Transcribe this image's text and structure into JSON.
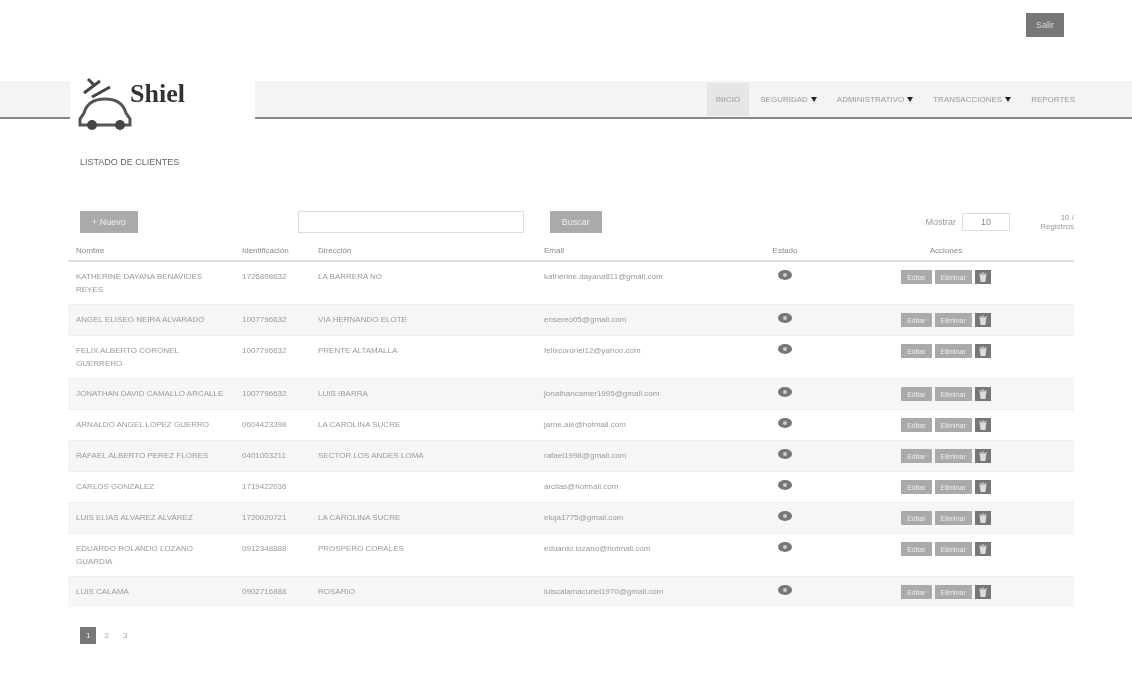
{
  "top_button": "Salir",
  "brand": "Shiel",
  "nav": [
    {
      "label": "INICIO",
      "selected": true,
      "dropdown": false
    },
    {
      "label": "SEGURIDAD",
      "selected": false,
      "dropdown": true
    },
    {
      "label": "ADMINISTRATIVO",
      "selected": false,
      "dropdown": true
    },
    {
      "label": "TRANSACCIONES",
      "selected": false,
      "dropdown": true
    },
    {
      "label": "REPORTES",
      "selected": false,
      "dropdown": false
    }
  ],
  "page_title": "LISTADO DE CLIENTES",
  "toolbar": {
    "new_button": "+ Nuevo",
    "search_button": "Buscar",
    "show_label": "Mostrar",
    "page_size": "10",
    "records_label": "10 / Registros"
  },
  "table": {
    "columns": [
      "Nombre",
      "Identificación",
      "Dirección",
      "Email",
      "Estado",
      "Acciones"
    ],
    "rows": [
      {
        "name": "KATHERINE DAYANA BENAVIDES REYES",
        "id": "1726808632",
        "address": "LA BARRERA NO",
        "email": "katherine.dayana811@gmail.com",
        "edit": "Editar",
        "delete": "Eliminar"
      },
      {
        "name": "ANGEL ELISEO NEIRA ALVARADO",
        "id": "1007796632",
        "address": "VIA HERNANDO ELOTE",
        "email": "ensereo05@gmail.com",
        "edit": "Editar",
        "delete": "Eliminar"
      },
      {
        "name": "FELIX ALBERTO CORONEL GUERRERO",
        "id": "1007796632",
        "address": "PRENTE ALTAMALLA",
        "email": "felixcoronel12@yahoo.com",
        "edit": "Editar",
        "delete": "Eliminar"
      },
      {
        "name": "JONATHAN DAVID CAMALLO ARCALLE",
        "id": "1007796632",
        "address": "LUIS IBARRA",
        "email": "jonathancamer1995@gmail.com",
        "edit": "Editar",
        "delete": "Eliminar"
      },
      {
        "name": "ARNALDO ANGEL LOPEZ GUERRO",
        "id": "0604423398",
        "address": "LA CAROLINA SUCRE",
        "email": "jarne.ale@hotmail.com",
        "edit": "Editar",
        "delete": "Eliminar"
      },
      {
        "name": "RAFAEL ALBERTO PEREZ FLORES",
        "id": "0401003211",
        "address": "SECTOR LOS ANDES LOMA",
        "email": "rafael1998@gmail.com",
        "edit": "Editar",
        "delete": "Eliminar"
      },
      {
        "name": "CARLOS GONZALEZ",
        "id": "1719422036",
        "email": "arcilas@hotmail.com",
        "edit": "Editar",
        "delete": "Eliminar"
      },
      {
        "name": "LUIS ELIAS ALVAREZ ALVAREZ",
        "id": "1720020721",
        "address": "LA CAROLINA SUCRE",
        "email": "eluja1775@gmail.com",
        "edit": "Editar",
        "delete": "Eliminar"
      },
      {
        "name": "EDUARDO ROLANDO LOZANO GUARDIA",
        "id": "0912348888",
        "address": "PROSPERO CORALES",
        "email": "eduardo.lozano@hotmail.com",
        "edit": "Editar",
        "delete": "Eliminar"
      },
      {
        "name": "LUIS CALAMA",
        "id": "0902716888",
        "address": "ROSARIO",
        "email": "luiscalamacuriel1970@gmail.com",
        "edit": "Editar",
        "delete": "Eliminar"
      }
    ]
  },
  "pagination": [
    {
      "label": "1",
      "selected": true
    },
    {
      "label": "2",
      "selected": false
    },
    {
      "label": "3",
      "selected": false
    }
  ]
}
